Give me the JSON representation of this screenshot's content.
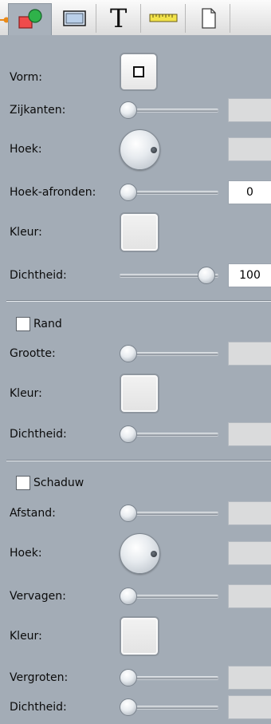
{
  "toolbar": {
    "tabs": [
      {
        "name": "shape-tab",
        "icon": "shape-icon"
      },
      {
        "name": "frame-tab",
        "icon": "frame-icon"
      },
      {
        "name": "text-tab",
        "icon": "text-icon",
        "glyph": "T"
      },
      {
        "name": "ruler-tab",
        "icon": "ruler-icon"
      },
      {
        "name": "page-tab",
        "icon": "page-icon"
      }
    ]
  },
  "shape": {
    "vorm_label": "Vorm:",
    "zijkanten_label": "Zijkanten:",
    "hoek_label": "Hoek:",
    "hoek_afronden_label": "Hoek-afronden:",
    "hoek_afronden_value": "0",
    "kleur_label": "Kleur:",
    "dichtheid_label": "Dichtheid:",
    "dichtheid_value": "100"
  },
  "rand": {
    "checkbox_label": "Rand",
    "grootte_label": "Grootte:",
    "kleur_label": "Kleur:",
    "dichtheid_label": "Dichtheid:"
  },
  "schaduw": {
    "checkbox_label": "Schaduw",
    "afstand_label": "Afstand:",
    "hoek_label": "Hoek:",
    "vervagen_label": "Vervagen:",
    "kleur_label": "Kleur:",
    "vergroten_label": "Vergroten:",
    "dichtheid_label": "Dichtheid:"
  }
}
